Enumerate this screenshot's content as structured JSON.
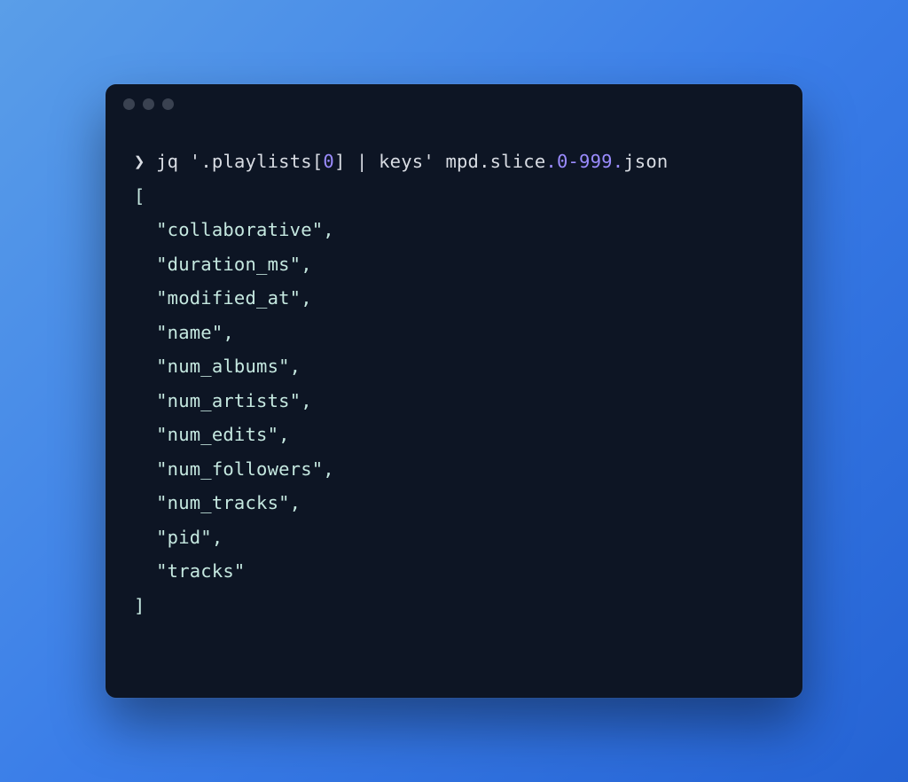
{
  "prompt": {
    "symbol": "❯",
    "cmd": "jq",
    "arg_prefix": "'.playlists[",
    "arg_index": "0",
    "arg_suffix": "] | keys'",
    "file_p1": "mpd.slice",
    "file_dot1": ".",
    "file_range": "0-999",
    "file_dot2": ".",
    "file_ext": "json"
  },
  "output": {
    "open": "[",
    "keys": [
      "  \"collaborative\",",
      "  \"duration_ms\",",
      "  \"modified_at\",",
      "  \"name\",",
      "  \"num_albums\",",
      "  \"num_artists\",",
      "  \"num_edits\",",
      "  \"num_followers\",",
      "  \"num_tracks\",",
      "  \"pid\",",
      "  \"tracks\""
    ],
    "close": "]"
  }
}
